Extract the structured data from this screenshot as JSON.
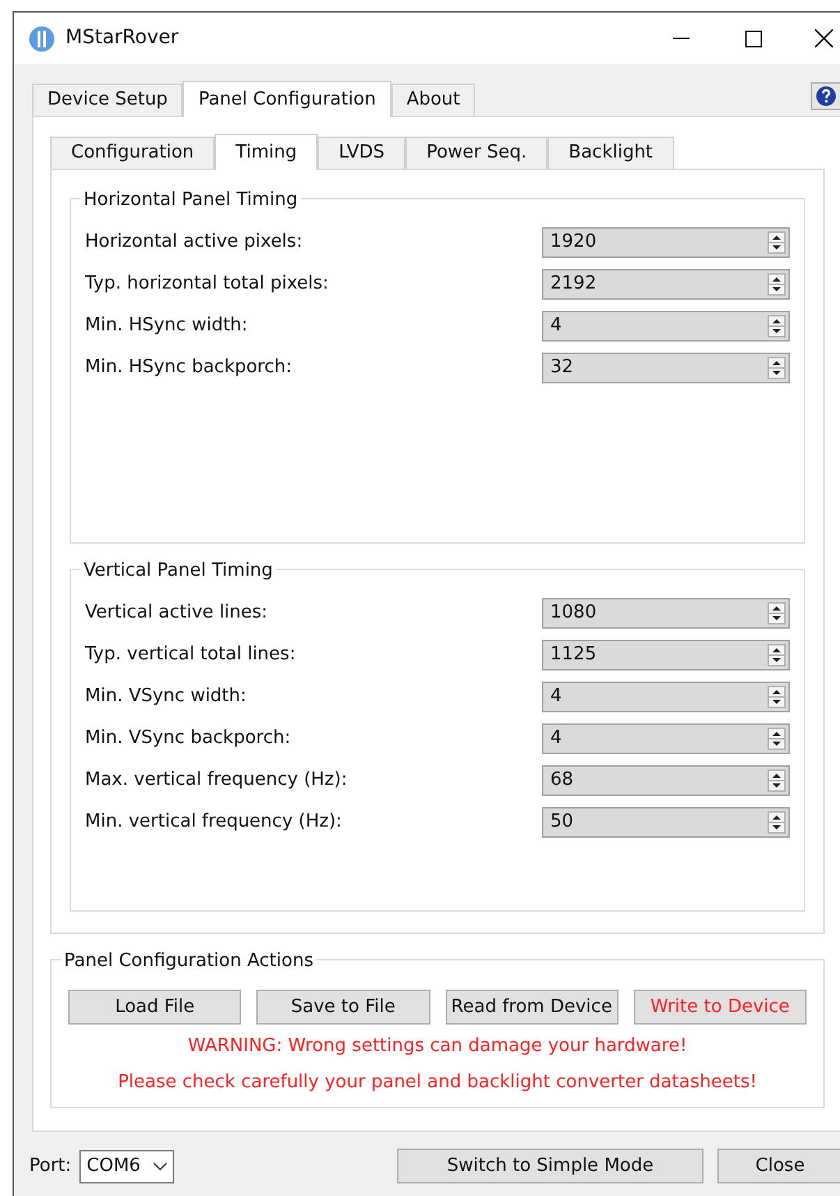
{
  "window": {
    "title": "MStarRover"
  },
  "tabs": [
    {
      "label": "Device Setup",
      "selected": false
    },
    {
      "label": "Panel Configuration",
      "selected": true
    },
    {
      "label": "About",
      "selected": false
    }
  ],
  "subtabs": [
    {
      "label": "Configuration",
      "selected": false
    },
    {
      "label": "Timing",
      "selected": true
    },
    {
      "label": "LVDS",
      "selected": false
    },
    {
      "label": "Power Seq.",
      "selected": false
    },
    {
      "label": "Backlight",
      "selected": false
    }
  ],
  "groups": [
    {
      "title": "Horizontal Panel Timing",
      "fields": [
        {
          "label": "Horizontal active pixels:",
          "value": "1920"
        },
        {
          "label": "Typ. horizontal total pixels:",
          "value": "2192"
        },
        {
          "label": "Min. HSync width:",
          "value": "4"
        },
        {
          "label": "Min. HSync backporch:",
          "value": "32"
        }
      ]
    },
    {
      "title": "Vertical Panel Timing",
      "fields": [
        {
          "label": "Vertical active lines:",
          "value": "1080"
        },
        {
          "label": "Typ. vertical total lines:",
          "value": "1125"
        },
        {
          "label": "Min. VSync width:",
          "value": "4"
        },
        {
          "label": "Min. VSync backporch:",
          "value": "4"
        },
        {
          "label": "Max. vertical frequency (Hz):",
          "value": "68"
        },
        {
          "label": "Min. vertical frequency (Hz):",
          "value": "50"
        }
      ]
    }
  ],
  "actions": {
    "title": "Panel Configuration Actions",
    "buttons": [
      {
        "label": "Load File",
        "kind": "normal"
      },
      {
        "label": "Save to File",
        "kind": "normal"
      },
      {
        "label": "Read from Device",
        "kind": "normal"
      },
      {
        "label": "Write to Device",
        "kind": "danger"
      }
    ],
    "warnings": [
      "WARNING: Wrong settings can damage your hardware!",
      "Please check carefully your panel and backlight converter datasheets!"
    ]
  },
  "port": {
    "label": "Port:",
    "value": "COM6"
  },
  "footer_buttons": [
    "Switch to Simple Mode",
    "Close"
  ]
}
